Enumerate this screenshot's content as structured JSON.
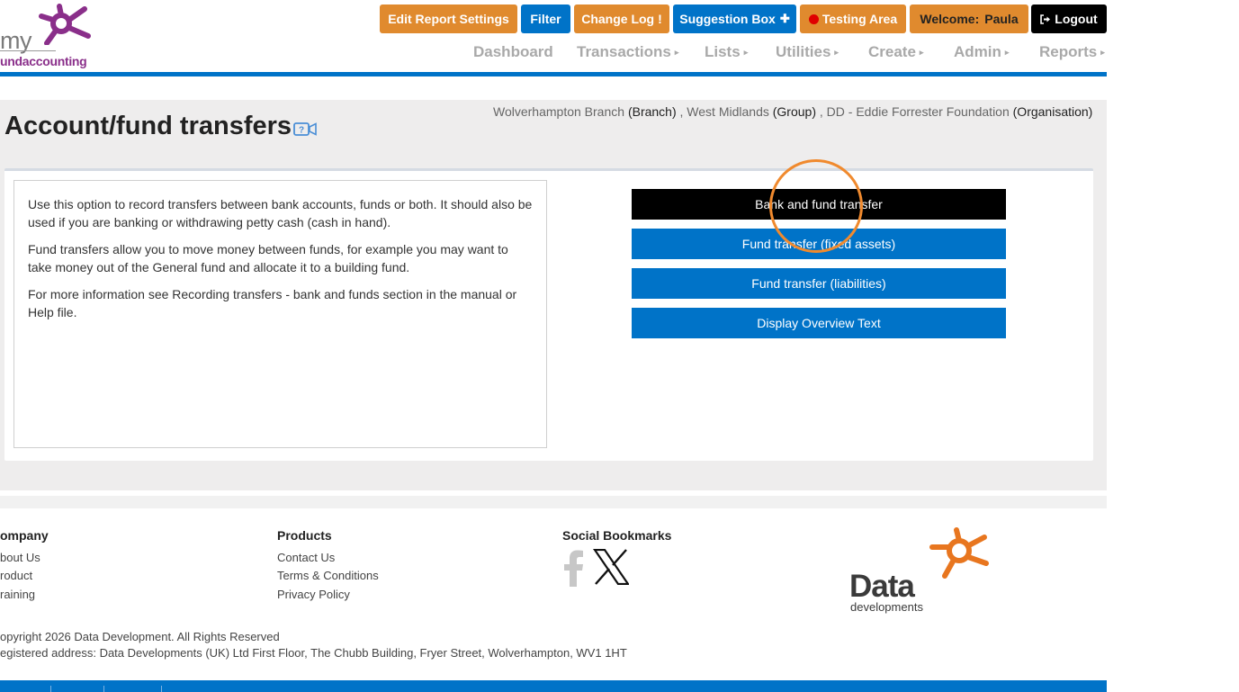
{
  "header": {
    "logo_text_top": "my",
    "logo_text_bottom": "undaccounting",
    "buttons": {
      "edit_report_settings": "Edit Report Settings",
      "filter": "Filter",
      "change_log": "Change Log",
      "change_log_mark": "!",
      "suggestion_box": "Suggestion Box",
      "suggestion_box_mark": "✚",
      "testing_area": "Testing Area",
      "welcome_prefix": "Welcome:",
      "welcome_user": "Paula",
      "logout": "Logout"
    },
    "nav": [
      "Dashboard",
      "Transactions",
      "Lists",
      "Utilities",
      "Create",
      "Admin",
      "Reports"
    ]
  },
  "page": {
    "title": "Account/fund transfers",
    "help_icon": "help-video-icon",
    "context": {
      "branch_name": "Wolverhampton Branch",
      "branch_type": "(Branch)",
      "group_name": "West Midlands",
      "group_type": "(Group)",
      "org_name": "DD - Eddie Forrester Foundation",
      "org_type": "(Organisation)"
    },
    "info_paragraphs": [
      "Use this option to record transfers between bank accounts, funds or both. It should also be used if you are banking or withdrawing petty cash (cash in hand).",
      "Fund transfers allow you to move money between funds, for example you may want to take money out of the General fund and allocate it to a building fund.",
      "For more information see Recording transfers - bank and funds section in the manual or Help file."
    ],
    "actions": [
      "Bank and fund transfer",
      "Fund transfer (fixed assets)",
      "Fund transfer (liabilities)",
      "Display Overview Text"
    ]
  },
  "footer": {
    "company_heading": "ompany",
    "company_links": [
      "bout Us",
      "roduct",
      "raining"
    ],
    "products_heading": "Products",
    "products_links": [
      "Contact Us",
      "Terms & Conditions",
      "Privacy Policy"
    ],
    "social_heading": "Social Bookmarks",
    "social_icons": [
      "facebook-icon",
      "x-icon"
    ],
    "brand_word": "Data",
    "brand_sub": "developments",
    "copyright": "opyright 2026 Data Development. All Rights Reserved",
    "address": "egistered address: Data Developments (UK) Ltd First Floor, The Chubb Building, Fryer Street, Wolverhampton, WV1 1HT"
  },
  "colors": {
    "accent_blue": "#0073c8",
    "accent_orange": "#e08a2e",
    "logo_purple": "#8a2f8a",
    "highlight_ring": "#f08a2e"
  }
}
